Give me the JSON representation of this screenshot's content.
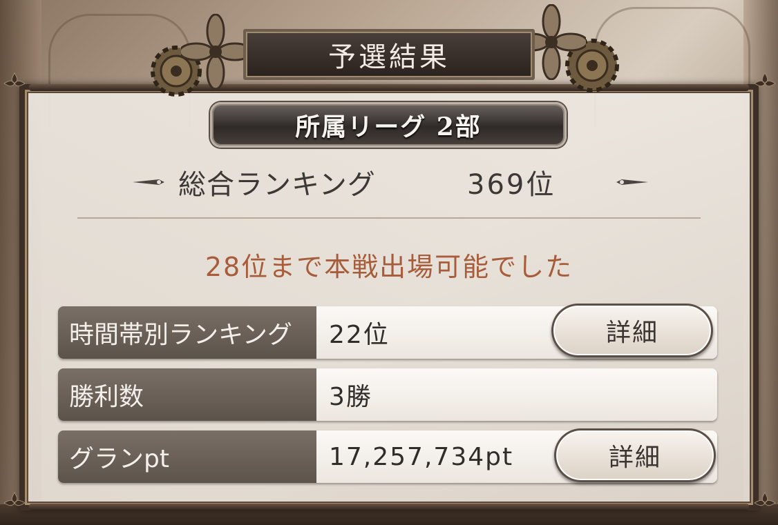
{
  "title": "予選結果",
  "league": "所属リーグ 2部",
  "overall": {
    "label": "総合ランキング",
    "value": "369位"
  },
  "notice": "28位まで本戦出場可能でした",
  "rows": [
    {
      "label": "時間帯別ランキング",
      "value": "22位",
      "button": "詳細"
    },
    {
      "label": "勝利数",
      "value": "3勝"
    },
    {
      "label": "グランpt",
      "value": "17,257,734pt",
      "button": "詳細"
    }
  ],
  "colors": {
    "notice": "#a75d3b",
    "frame": "#3d2f26",
    "label_bg": "#6b6158"
  }
}
